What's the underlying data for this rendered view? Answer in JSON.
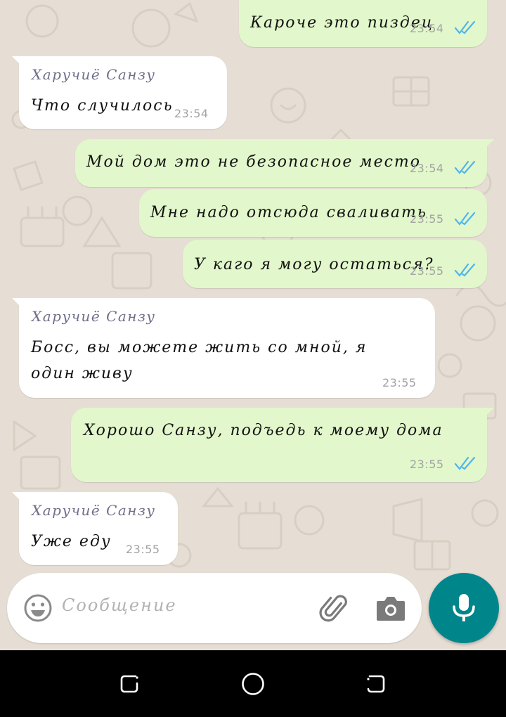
{
  "chat": {
    "messages": [
      {
        "direction": "out",
        "text": "Кароче это пиздец",
        "time": "23:54",
        "status": "read"
      },
      {
        "direction": "in",
        "sender": "Харучиё Санзу",
        "text": "Что случилось",
        "time": "23:54"
      },
      {
        "direction": "out",
        "text": "Мой дом это не безопасное место",
        "time": "23:54",
        "status": "read"
      },
      {
        "direction": "out",
        "text": "Мне надо отсюда сваливать",
        "time": "23:55",
        "status": "read"
      },
      {
        "direction": "out",
        "text": "У каго я могу остаться?",
        "time": "23:55",
        "status": "read"
      },
      {
        "direction": "in",
        "sender": "Харучиё Санзу",
        "text_line1": "Босс, вы можете жить со мной, я",
        "text_line2": "один живу",
        "time": "23:55"
      },
      {
        "direction": "out",
        "text": "Хорошо Санзу, подъедь к моему дома",
        "time": "23:55",
        "status": "read"
      },
      {
        "direction": "in",
        "sender": "Харучиё Санзу",
        "text": "Уже еду",
        "time": "23:55"
      }
    ]
  },
  "composer": {
    "placeholder": "Сообщение",
    "emoji_icon": "emoji-icon",
    "attach_icon": "paperclip-icon",
    "camera_icon": "camera-icon",
    "mic_icon": "microphone-icon"
  },
  "navbar": {
    "recents_icon": "recents-icon",
    "home_icon": "home-icon",
    "back_icon": "back-icon"
  },
  "colors": {
    "outgoing_bubble": "#e2f7cb",
    "incoming_bubble": "#ffffff",
    "read_ticks": "#4fb6ec",
    "mic_button": "#00868a",
    "sender_name": "#6e6e8a"
  }
}
